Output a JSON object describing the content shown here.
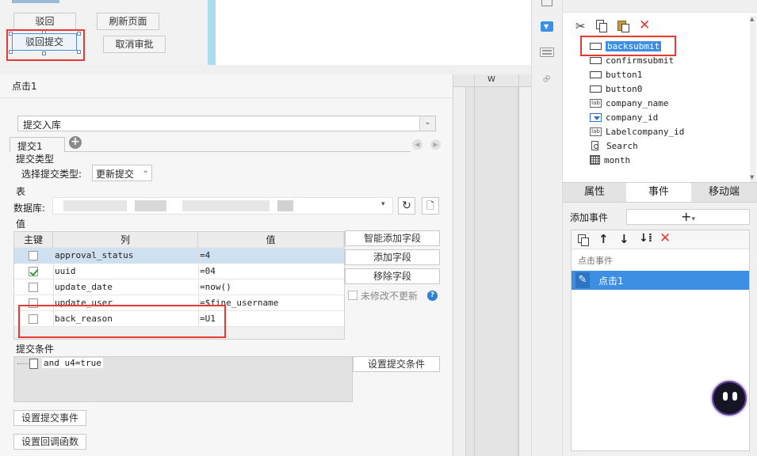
{
  "toolbar": {
    "reject_label": "驳回",
    "refresh_label": "刷新页面",
    "reject_submit_label": "驳回提交",
    "cancel_approval_label": "取消审批"
  },
  "dialog": {
    "title": "点击1",
    "event_type_value": "提交入库",
    "tab_label": "提交1",
    "submit_type_section": "提交类型",
    "submit_type_label": "选择提交类型:",
    "submit_type_value": "更新提交",
    "table_section": "表",
    "database_label": "数据库:",
    "value_section": "值",
    "columns": {
      "key": "主键",
      "column": "列",
      "value": "值"
    },
    "rows": [
      {
        "checked": false,
        "column": "approval_status",
        "value": "=4"
      },
      {
        "checked": true,
        "column": "uuid",
        "value": "=04"
      },
      {
        "checked": false,
        "column": "update_date",
        "value": "=now()"
      },
      {
        "checked": false,
        "column": "update_user",
        "value": "=$fine_username"
      },
      {
        "checked": false,
        "column": "back_reason",
        "value": "=U1"
      }
    ],
    "smart_add_label": "智能添加字段",
    "add_field_label": "添加字段",
    "remove_field_label": "移除字段",
    "no_update_label": "未修改不更新",
    "condition_section": "提交条件",
    "condition_item": "and u4=true",
    "set_condition_label": "设置提交条件",
    "set_submit_event_label": "设置提交事件",
    "set_callback_label": "设置回调函数"
  },
  "sheet": {
    "col_w": "W"
  },
  "widget_tree": {
    "items": [
      {
        "icon": "button-widget-icon",
        "name": "backsubmit",
        "selected": true
      },
      {
        "icon": "button-widget-icon",
        "name": "confirmsubmit"
      },
      {
        "icon": "button-widget-icon",
        "name": "button1"
      },
      {
        "icon": "button-widget-icon",
        "name": "button0"
      },
      {
        "icon": "label-widget-icon",
        "name": "company_name"
      },
      {
        "icon": "combo-widget-icon",
        "name": "company_id"
      },
      {
        "icon": "label-widget-icon",
        "name": "Labelcompany_id"
      },
      {
        "icon": "search-widget-icon",
        "name": "Search"
      },
      {
        "icon": "date-widget-icon",
        "name": "month"
      }
    ]
  },
  "panel_tabs": {
    "properties": "属性",
    "events": "事件",
    "mobile": "移动端"
  },
  "events_panel": {
    "add_event_label": "添加事件",
    "group_label": "点击事件",
    "event_item": "点击1"
  },
  "colors": {
    "accent": "#3d8fe4",
    "highlight": "#e53935",
    "row_selected": "#cfe0f1"
  }
}
